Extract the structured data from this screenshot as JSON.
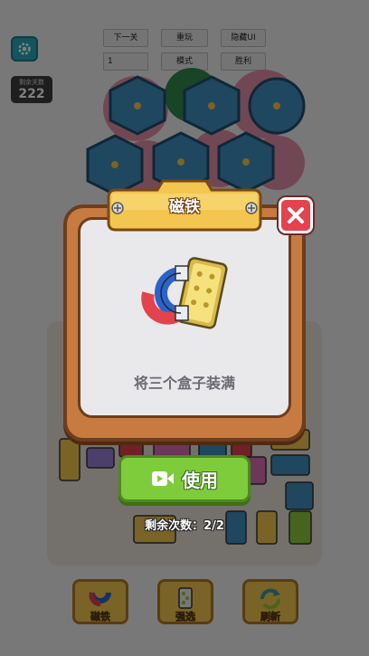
{
  "debug": {
    "next_level": "下一关",
    "replay": "重玩",
    "hide_ui": "隐藏UI",
    "level_select": "1",
    "mode": "模式",
    "win": "胜利"
  },
  "score": {
    "label": "剩余关数",
    "value": "222"
  },
  "popup": {
    "title": "磁铁",
    "description": "将三个盒子装满",
    "use_label": "使用",
    "remaining_prefix": "剩余次数：",
    "remaining_value": "2/2"
  },
  "tools": [
    {
      "label": "磁铁",
      "icon": "magnet-icon"
    },
    {
      "label": "强选",
      "icon": "card-select-icon"
    },
    {
      "label": "刷新",
      "icon": "refresh-icon"
    }
  ],
  "colors": {
    "popup_frame": "#c77b40",
    "use_button": "#7ecb3b",
    "close_button": "#e2434d",
    "title_plate": "#f3c64f"
  }
}
